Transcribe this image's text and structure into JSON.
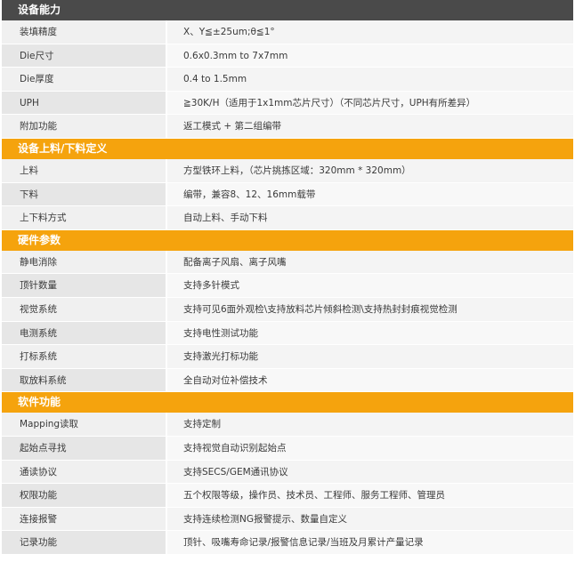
{
  "sections": [
    {
      "title": "设备能力",
      "style": "dark",
      "rows": [
        {
          "label": "装填精度",
          "value": "X、Y≦±25um;θ≦1°"
        },
        {
          "label": "Die尺寸",
          "value": "0.6x0.3mm to 7x7mm"
        },
        {
          "label": "Die厚度",
          "value": "0.4 to 1.5mm"
        },
        {
          "label": "UPH",
          "value": "≧30K/H（适用于1x1mm芯片尺寸）（不同芯片尺寸，UPH有所差异）"
        },
        {
          "label": "附加功能",
          "value": "返工模式 + 第二组编带"
        }
      ]
    },
    {
      "title": "设备上料/下料定义",
      "style": "orange",
      "rows": [
        {
          "label": "上料",
          "value": "方型铁环上料，（芯片挑拣区域：320mm * 320mm）"
        },
        {
          "label": "下料",
          "value": "编带，兼容8、12、16mm载带"
        },
        {
          "label": "上下料方式",
          "value": "自动上料、手动下料"
        }
      ]
    },
    {
      "title": "硬件参数",
      "style": "orange",
      "rows": [
        {
          "label": "静电消除",
          "value": "配备离子风扇、离子风嘴"
        },
        {
          "label": "顶针数量",
          "value": "支持多针模式"
        },
        {
          "label": "视觉系统",
          "value": "支持可见6面外观检\\支持放料芯片倾斜检测\\支持热封封痕视觉检测"
        },
        {
          "label": "电测系统",
          "value": "支持电性测试功能"
        },
        {
          "label": "打标系统",
          "value": "支持激光打标功能"
        },
        {
          "label": "取放料系统",
          "value": "全自动对位补偿技术"
        }
      ]
    },
    {
      "title": "软件功能",
      "style": "orange",
      "rows": [
        {
          "label": "Mapping读取",
          "value": "支持定制"
        },
        {
          "label": "起始点寻找",
          "value": "支持视觉自动识别起始点"
        },
        {
          "label": "通读协议",
          "value": "支持SECS/GEM通讯协议"
        },
        {
          "label": "权限功能",
          "value": "五个权限等级，操作员、技术员、工程师、服务工程师、管理员"
        },
        {
          "label": "连接报警",
          "value": "支持连续检测NG报警提示、数量自定义"
        },
        {
          "label": "记录功能",
          "value": "顶针、吸嘴寿命记录/报警信息记录/当班及月累计产量记录"
        }
      ]
    }
  ]
}
